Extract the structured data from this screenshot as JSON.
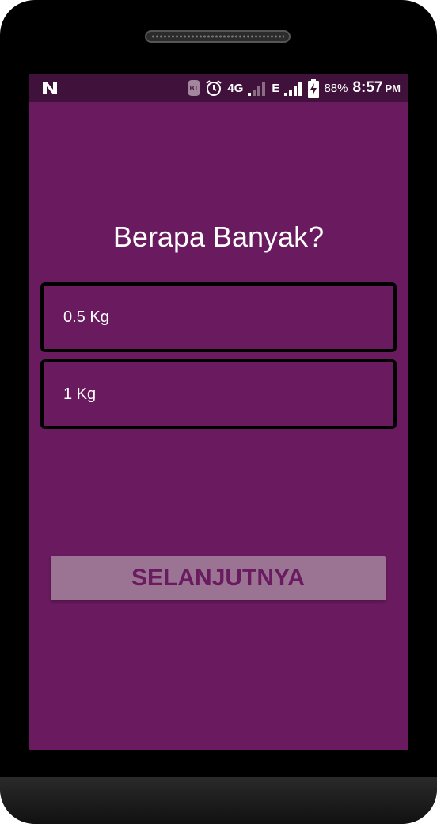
{
  "status_bar": {
    "left_icon": "n-notification-icon",
    "icons": [
      "bluetooth-icon",
      "alarm-clock-icon"
    ],
    "network_label": "4G",
    "edge_label": "E",
    "battery_percent": "88%",
    "time": "8:57",
    "ampm": "PM"
  },
  "screen": {
    "title": "Berapa Banyak?",
    "options": [
      {
        "label": "0.5 Kg"
      },
      {
        "label": "1 Kg"
      }
    ],
    "next_button_label": "SELANJUTNYA"
  },
  "colors": {
    "background": "#6a1a5e",
    "status_bar": "#40113a",
    "button_bg": "#9b7393",
    "button_text": "#6a1a5e",
    "option_border": "#000000"
  }
}
